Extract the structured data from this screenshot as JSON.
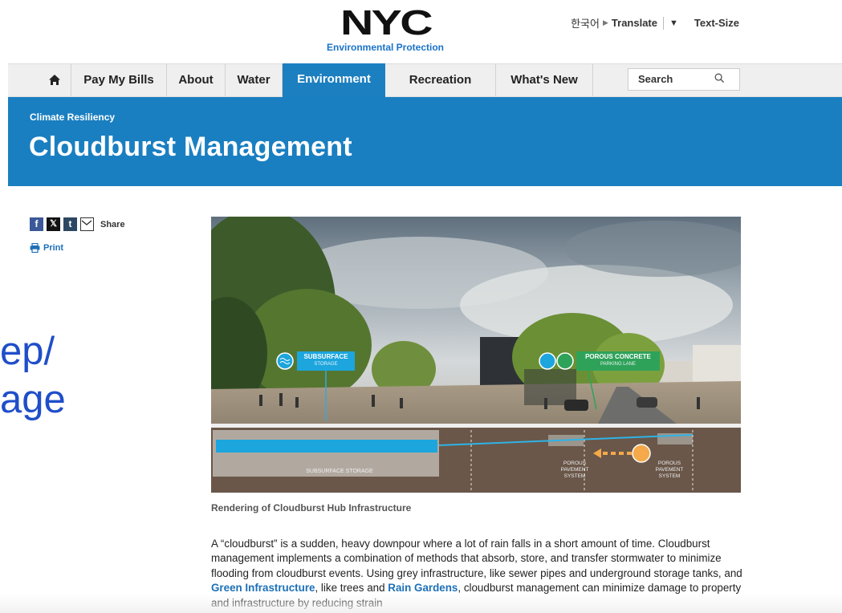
{
  "header": {
    "logo_text": "NYC",
    "logo_subtitle": "Environmental Protection",
    "language": "한국어",
    "translate_label": "Translate",
    "translate_dropdown": "▼",
    "text_size_label": "Text-Size"
  },
  "nav": {
    "home_icon": "home-icon",
    "items": [
      "Pay My Bills",
      "About",
      "Water",
      "Environment",
      "Recreation",
      "What's New"
    ],
    "active": "Environment",
    "search_placeholder": "Search"
  },
  "hero": {
    "breadcrumb": "Climate Resiliency",
    "title": "Cloudburst Management",
    "color": "#1a7fc1"
  },
  "share": {
    "icons": [
      "facebook-icon",
      "x-icon",
      "tumblr-icon",
      "email-icon"
    ],
    "share_label": "Share",
    "print_label": "Print"
  },
  "overlay": {
    "line1": "ep/",
    "line2": "age"
  },
  "figure": {
    "labels": {
      "subsurface_storage_title": "SUBSURFACE",
      "subsurface_storage_sub": "STORAGE",
      "porous_concrete_title": "POROUS CONCRETE",
      "porous_concrete_sub": "PARKING LANE",
      "ground_subsurface": "SUBSURFACE STORAGE",
      "porous_pavement_1": "POROUS PAVEMENT SYSTEM",
      "porous_pavement_2": "POROUS PAVEMENT SYSTEM"
    },
    "caption": "Rendering of Cloudburst Hub Infrastructure"
  },
  "body": {
    "p1_a": "A “cloudburst” is a sudden, heavy downpour where a lot of rain falls in a short amount of time. Cloudburst management implements a combination of methods that absorb, store, and transfer stormwater to minimize flooding from cloudburst events. Using grey infrastructure, like sewer pipes and underground storage tanks, and ",
    "link1": "Green Infrastructure",
    "p1_b": ", like trees and ",
    "link2": "Rain Gardens",
    "p1_c": ", cloudburst management can minimize damage to property and infrastructure by reducing strain"
  }
}
